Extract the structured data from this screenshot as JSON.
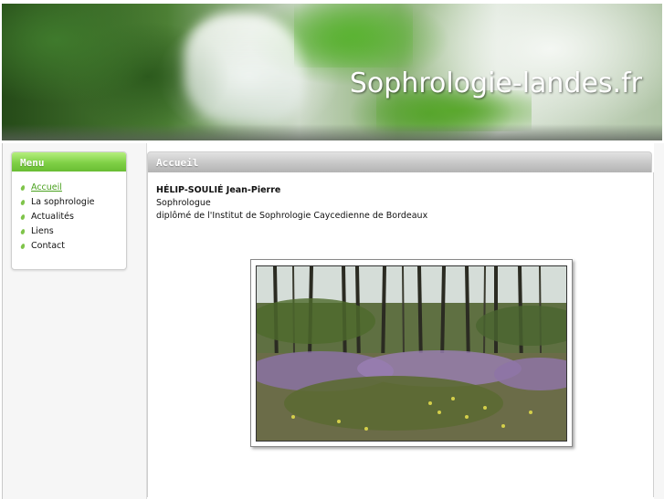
{
  "header": {
    "site_title": "Sophrologie-landes.fr"
  },
  "menu": {
    "title": "Menu",
    "items": [
      {
        "label": "Accueil",
        "active": true
      },
      {
        "label": "La sophrologie",
        "active": false
      },
      {
        "label": "Actualités",
        "active": false
      },
      {
        "label": "Liens",
        "active": false
      },
      {
        "label": "Contact",
        "active": false
      }
    ]
  },
  "content": {
    "title": "Accueil",
    "name": "HÉLIP-SOULIÉ Jean-Pierre",
    "profession": "Sophrologue",
    "diploma": "diplômé de l'Institut de Sophrologie Caycedienne de Bordeaux"
  },
  "colors": {
    "menu_header": "#7fd046",
    "active_link": "#4aa11f",
    "content_header": "#c6c6c6"
  }
}
